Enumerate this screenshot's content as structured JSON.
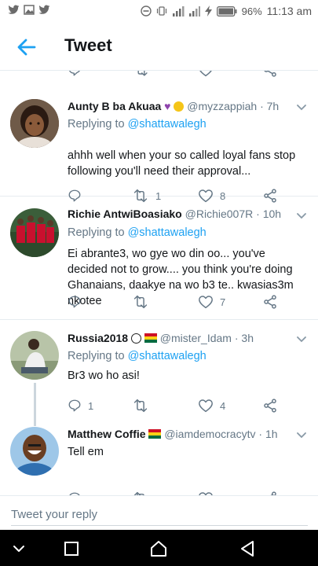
{
  "status_bar": {
    "battery": "96%",
    "time": "11:13 am"
  },
  "app_bar": {
    "title": "Tweet"
  },
  "tweets": [
    {
      "name": "Aunty B ba Akuaa",
      "handle": "@myzzappiah",
      "time": "7h",
      "reply_prefix": "Replying to ",
      "mention": "@shattawalegh",
      "text": "ahhh well when your so called loyal fans stop following you'll need their approval...",
      "retweets": "1",
      "likes": "8"
    },
    {
      "name": "Richie AntwiBoasiako",
      "handle": "@Richie007R",
      "time": "10h",
      "reply_prefix": "Replying to ",
      "mention": "@shattawalegh",
      "text": "Ei abrante3, wo gye wo din oo... you've decided not to grow.... you think you're doing Ghanaians, daakye na wo b3 te.. kwasias3m nkotee",
      "retweets": "",
      "likes": "7"
    },
    {
      "name": "Russia2018",
      "handle": "@mister_Idam",
      "time": "3h",
      "reply_prefix": "Replying to ",
      "mention": "@shattawalegh",
      "text": "Br3 wo ho asi!",
      "replies": "1",
      "retweets": "",
      "likes": "4"
    },
    {
      "name": "Matthew Coffie",
      "handle": "@iamdemocracytv",
      "time": "1h",
      "text": "Tell em"
    }
  ],
  "separator": " · ",
  "composer": {
    "placeholder": "Tweet your reply"
  },
  "colors": {
    "accent": "#1da1f2",
    "text_secondary": "#657786",
    "divider": "#e6ecf0"
  }
}
